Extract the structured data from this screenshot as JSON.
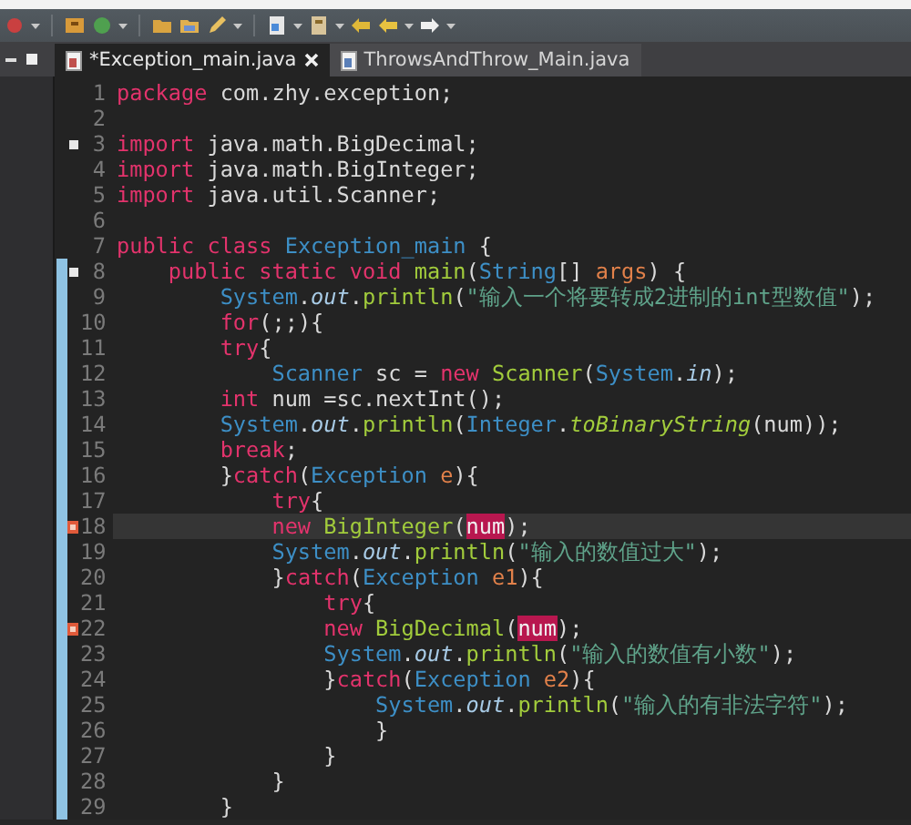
{
  "tabs": [
    {
      "label": "*Exception_main.java",
      "selected": true,
      "closable": true
    },
    {
      "label": "ThrowsAndThrow_Main.java",
      "selected": false,
      "closable": false
    }
  ],
  "lines": [
    {
      "number": "1",
      "foldable": false,
      "error": false,
      "current": false,
      "in_range": false,
      "tokens": [
        {
          "kind": "keyword",
          "text": "package"
        },
        {
          "kind": "plain",
          "text": " com.zhy.exception;"
        }
      ]
    },
    {
      "number": "2",
      "foldable": false,
      "error": false,
      "current": false,
      "in_range": false
    },
    {
      "number": "3",
      "foldable": true,
      "error": false,
      "current": false,
      "in_range": false,
      "tokens": [
        {
          "kind": "keyword",
          "text": "import"
        },
        {
          "kind": "plain",
          "text": " java.math.BigDecimal;"
        }
      ]
    },
    {
      "number": "4",
      "foldable": false,
      "error": false,
      "current": false,
      "in_range": false,
      "tokens": [
        {
          "kind": "keyword",
          "text": "import"
        },
        {
          "kind": "plain",
          "text": " java.math.BigInteger;"
        }
      ]
    },
    {
      "number": "5",
      "foldable": false,
      "error": false,
      "current": false,
      "in_range": false,
      "tokens": [
        {
          "kind": "keyword",
          "text": "import"
        },
        {
          "kind": "plain",
          "text": " java.util.Scanner;"
        }
      ]
    },
    {
      "number": "6",
      "foldable": false,
      "error": false,
      "current": false,
      "in_range": false
    },
    {
      "number": "7",
      "foldable": false,
      "error": false,
      "current": false,
      "in_range": false,
      "tokens": [
        {
          "kind": "keyword",
          "text": "public class"
        },
        {
          "kind": "type",
          "text": " Exception_main"
        },
        {
          "kind": "plain",
          "text": " {"
        }
      ]
    },
    {
      "number": "8",
      "foldable": true,
      "error": false,
      "current": false,
      "in_range": true,
      "tokens": [
        {
          "kind": "keyword",
          "text": "    public static void"
        },
        {
          "kind": "method",
          "text": " main"
        },
        {
          "kind": "plain",
          "text": "("
        },
        {
          "kind": "type",
          "text": "String"
        },
        {
          "kind": "plain",
          "text": "[] "
        },
        {
          "kind": "param",
          "text": "args"
        },
        {
          "kind": "plain",
          "text": ") {"
        }
      ]
    },
    {
      "number": "9",
      "foldable": false,
      "error": false,
      "current": false,
      "in_range": true,
      "tokens": [
        {
          "kind": "type",
          "text": "        System"
        },
        {
          "kind": "plain",
          "text": "."
        },
        {
          "kind": "field",
          "text": "out"
        },
        {
          "kind": "plain",
          "text": "."
        },
        {
          "kind": "method",
          "text": "println"
        },
        {
          "kind": "plain",
          "text": "("
        },
        {
          "kind": "string",
          "text": "\"输入一个将要转成2进制的int型数值\""
        },
        {
          "kind": "plain",
          "text": ");"
        }
      ]
    },
    {
      "number": "10",
      "foldable": false,
      "error": false,
      "current": false,
      "in_range": true,
      "tokens": [
        {
          "kind": "keyword",
          "text": "        for"
        },
        {
          "kind": "plain",
          "text": "(;;){"
        }
      ]
    },
    {
      "number": "11",
      "foldable": false,
      "error": false,
      "current": false,
      "in_range": true,
      "tokens": [
        {
          "kind": "keyword",
          "text": "        try"
        },
        {
          "kind": "plain",
          "text": "{"
        }
      ]
    },
    {
      "number": "12",
      "foldable": false,
      "error": false,
      "current": false,
      "in_range": true,
      "tokens": [
        {
          "kind": "type",
          "text": "            Scanner"
        },
        {
          "kind": "plain",
          "text": " sc = "
        },
        {
          "kind": "keyword",
          "text": "new"
        },
        {
          "kind": "method",
          "text": " Scanner"
        },
        {
          "kind": "plain",
          "text": "("
        },
        {
          "kind": "type",
          "text": "System"
        },
        {
          "kind": "plain",
          "text": "."
        },
        {
          "kind": "field",
          "text": "in"
        },
        {
          "kind": "plain",
          "text": ");"
        }
      ]
    },
    {
      "number": "13",
      "foldable": false,
      "error": false,
      "current": false,
      "in_range": true,
      "tokens": [
        {
          "kind": "keyword",
          "text": "        int"
        },
        {
          "kind": "plain",
          "text": " num =sc.nextInt();"
        }
      ]
    },
    {
      "number": "14",
      "foldable": false,
      "error": false,
      "current": false,
      "in_range": true,
      "tokens": [
        {
          "kind": "type",
          "text": "        System"
        },
        {
          "kind": "plain",
          "text": "."
        },
        {
          "kind": "field",
          "text": "out"
        },
        {
          "kind": "plain",
          "text": "."
        },
        {
          "kind": "method",
          "text": "println"
        },
        {
          "kind": "plain",
          "text": "("
        },
        {
          "kind": "type",
          "text": "Integer"
        },
        {
          "kind": "plain",
          "text": "."
        },
        {
          "kind": "static",
          "text": "toBinaryString"
        },
        {
          "kind": "plain",
          "text": "(num));"
        }
      ]
    },
    {
      "number": "15",
      "foldable": false,
      "error": false,
      "current": false,
      "in_range": true,
      "tokens": [
        {
          "kind": "keyword",
          "text": "        break"
        },
        {
          "kind": "plain",
          "text": ";"
        }
      ]
    },
    {
      "number": "16",
      "foldable": false,
      "error": false,
      "current": false,
      "in_range": true,
      "tokens": [
        {
          "kind": "plain",
          "text": "        }"
        },
        {
          "kind": "keyword",
          "text": "catch"
        },
        {
          "kind": "plain",
          "text": "("
        },
        {
          "kind": "type",
          "text": "Exception"
        },
        {
          "kind": "param",
          "text": " e"
        },
        {
          "kind": "plain",
          "text": "){"
        }
      ]
    },
    {
      "number": "17",
      "foldable": false,
      "error": false,
      "current": false,
      "in_range": true,
      "tokens": [
        {
          "kind": "keyword",
          "text": "            try"
        },
        {
          "kind": "plain",
          "text": "{"
        }
      ]
    },
    {
      "number": "18",
      "foldable": false,
      "error": true,
      "current": true,
      "in_range": true,
      "tokens": [
        {
          "kind": "keyword",
          "text": "            new"
        },
        {
          "kind": "method",
          "text": " BigInteger"
        },
        {
          "kind": "plain",
          "text": "("
        },
        {
          "kind": "occurrence",
          "text": "num"
        },
        {
          "kind": "plain",
          "text": ");"
        }
      ]
    },
    {
      "number": "19",
      "foldable": false,
      "error": false,
      "current": false,
      "in_range": true,
      "tokens": [
        {
          "kind": "type",
          "text": "            System"
        },
        {
          "kind": "plain",
          "text": "."
        },
        {
          "kind": "field",
          "text": "out"
        },
        {
          "kind": "plain",
          "text": "."
        },
        {
          "kind": "method",
          "text": "println"
        },
        {
          "kind": "plain",
          "text": "("
        },
        {
          "kind": "string",
          "text": "\"输入的数值过大\""
        },
        {
          "kind": "plain",
          "text": ");"
        }
      ]
    },
    {
      "number": "20",
      "foldable": false,
      "error": false,
      "current": false,
      "in_range": true,
      "tokens": [
        {
          "kind": "plain",
          "text": "            }"
        },
        {
          "kind": "keyword",
          "text": "catch"
        },
        {
          "kind": "plain",
          "text": "("
        },
        {
          "kind": "type",
          "text": "Exception"
        },
        {
          "kind": "param",
          "text": " e1"
        },
        {
          "kind": "plain",
          "text": "){"
        }
      ]
    },
    {
      "number": "21",
      "foldable": false,
      "error": false,
      "current": false,
      "in_range": true,
      "tokens": [
        {
          "kind": "keyword",
          "text": "                try"
        },
        {
          "kind": "plain",
          "text": "{"
        }
      ]
    },
    {
      "number": "22",
      "foldable": false,
      "error": true,
      "current": false,
      "in_range": true,
      "tokens": [
        {
          "kind": "keyword",
          "text": "                new"
        },
        {
          "kind": "method",
          "text": " BigDecimal"
        },
        {
          "kind": "plain",
          "text": "("
        },
        {
          "kind": "occurrence",
          "text": "num"
        },
        {
          "kind": "plain",
          "text": ");"
        }
      ]
    },
    {
      "number": "23",
      "foldable": false,
      "error": false,
      "current": false,
      "in_range": true,
      "tokens": [
        {
          "kind": "type",
          "text": "                System"
        },
        {
          "kind": "plain",
          "text": "."
        },
        {
          "kind": "field",
          "text": "out"
        },
        {
          "kind": "plain",
          "text": "."
        },
        {
          "kind": "method",
          "text": "println"
        },
        {
          "kind": "plain",
          "text": "("
        },
        {
          "kind": "string",
          "text": "\"输入的数值有小数\""
        },
        {
          "kind": "plain",
          "text": ");"
        }
      ]
    },
    {
      "number": "24",
      "foldable": false,
      "error": false,
      "current": false,
      "in_range": true,
      "tokens": [
        {
          "kind": "plain",
          "text": "                }"
        },
        {
          "kind": "keyword",
          "text": "catch"
        },
        {
          "kind": "plain",
          "text": "("
        },
        {
          "kind": "type",
          "text": "Exception"
        },
        {
          "kind": "param",
          "text": " e2"
        },
        {
          "kind": "plain",
          "text": "){"
        }
      ]
    },
    {
      "number": "25",
      "foldable": false,
      "error": false,
      "current": false,
      "in_range": true,
      "tokens": [
        {
          "kind": "type",
          "text": "                    System"
        },
        {
          "kind": "plain",
          "text": "."
        },
        {
          "kind": "field",
          "text": "out"
        },
        {
          "kind": "plain",
          "text": "."
        },
        {
          "kind": "method",
          "text": "println"
        },
        {
          "kind": "plain",
          "text": "("
        },
        {
          "kind": "string",
          "text": "\"输入的有非法字符\""
        },
        {
          "kind": "plain",
          "text": ");"
        }
      ]
    },
    {
      "number": "26",
      "foldable": false,
      "error": false,
      "current": false,
      "in_range": true,
      "tokens": [
        {
          "kind": "plain",
          "text": "                    }"
        }
      ]
    },
    {
      "number": "27",
      "foldable": false,
      "error": false,
      "current": false,
      "in_range": true,
      "tokens": [
        {
          "kind": "plain",
          "text": "                }"
        }
      ]
    },
    {
      "number": "28",
      "foldable": false,
      "error": false,
      "current": false,
      "in_range": true,
      "tokens": [
        {
          "kind": "plain",
          "text": "            }"
        }
      ]
    },
    {
      "number": "29",
      "foldable": false,
      "error": false,
      "current": false,
      "in_range": true,
      "tokens": [
        {
          "kind": "plain",
          "text": "        }"
        }
      ]
    }
  ]
}
